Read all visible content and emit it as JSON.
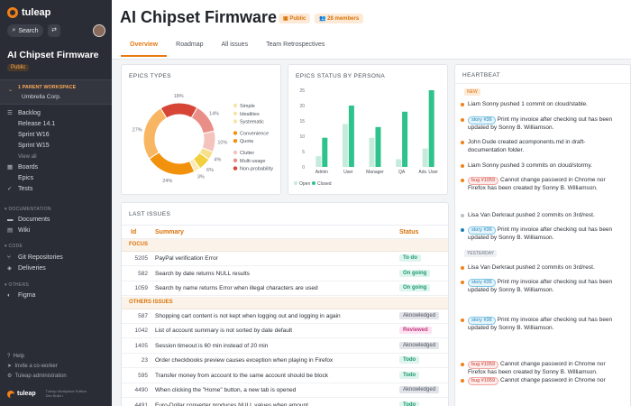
{
  "sidebar": {
    "brand": "tuleap",
    "search_label": "Search",
    "project_title": "AI Chipset Firmware",
    "public_label": "Public",
    "parent_ws_label": "1 PARENT WORKSPACE",
    "parent_ws_value": "Umbrella Corp.",
    "nav1": [
      {
        "label": "Backlog",
        "icon": "list-icon",
        "sub": false
      },
      {
        "label": "Release 14.1",
        "sub": true
      },
      {
        "label": "Sprint W16",
        "sub": true
      },
      {
        "label": "Sprint W15",
        "sub": true
      },
      {
        "label": "View all",
        "sub": true,
        "muted": true
      },
      {
        "label": "Boards",
        "icon": "board-icon",
        "sub": false
      },
      {
        "label": "Epics",
        "icon": "",
        "sub": false
      },
      {
        "label": "Tests",
        "icon": "check-icon",
        "sub": false
      }
    ],
    "section_doc": "DOCUMENTATION",
    "nav2": [
      {
        "label": "Documents",
        "icon": "folder-icon"
      },
      {
        "label": "Wiki",
        "icon": "book-icon"
      }
    ],
    "section_code": "CODE",
    "nav3": [
      {
        "label": "Git Repositories",
        "icon": "git-icon"
      },
      {
        "label": "Deliveries",
        "icon": "box-icon"
      }
    ],
    "section_others": "OTHERS",
    "nav4": [
      {
        "label": "Figma",
        "icon": "figma-icon"
      }
    ],
    "footer": [
      "Help",
      "Invite a co-worker",
      "Tuleap administration"
    ],
    "footer_brand": "tuleap",
    "footer_note": [
      "Tuleap Workplace Edition",
      "Dev Build •"
    ]
  },
  "header": {
    "title": "AI Chipset Firmware",
    "badge_public": "Public",
    "badge_members": "28 members",
    "tabs": [
      "Overview",
      "Roadmap",
      "All issues",
      "Team Retrospectives"
    ],
    "active_tab": 0
  },
  "epics_types": {
    "title": "EPICS TYPES",
    "slices": [
      {
        "label": "Simple",
        "value": 18,
        "color": "#d64535"
      },
      {
        "label": "Idealities",
        "value": 14,
        "color": "#ea8f88"
      },
      {
        "label": "Systematic",
        "value": 10,
        "color": "#f5c3bd"
      },
      {
        "label": "Convenience",
        "value": 4,
        "color": "#f6e18a"
      },
      {
        "label": "Quota",
        "value": 6,
        "color": "#f2cf3d"
      },
      {
        "label": "Clutter",
        "value": 3,
        "color": "#fbe9b6"
      },
      {
        "label": "Multi-usage",
        "value": 24,
        "color": "#f2920c"
      },
      {
        "label": "Non-probability",
        "value": 27,
        "color": "#f8b663"
      }
    ],
    "legend": [
      {
        "label": "Simple",
        "color": "#f5e6a8"
      },
      {
        "label": "Idealities",
        "color": "#f5e6a8"
      },
      {
        "label": "Systematic",
        "color": "#f5e6a8"
      },
      {
        "label": "Convenience",
        "color": "#f2920c"
      },
      {
        "label": "Quota",
        "color": "#f2920c"
      },
      {
        "label": "Clutter",
        "color": "#f5c3bd"
      },
      {
        "label": "Multi-usage",
        "color": "#ea8f88"
      },
      {
        "label": "Non-probability",
        "color": "#d64535"
      }
    ]
  },
  "chart_data": {
    "type": "bar",
    "title": "EPICS STATUS BY PERSONA",
    "categories": [
      "Admin",
      "User",
      "Manager",
      "QA",
      "Adv. User"
    ],
    "series": [
      {
        "name": "Open",
        "values": [
          3.5,
          14,
          9.5,
          2.5,
          6
        ],
        "color": "#c6ebdd"
      },
      {
        "name": "Closed",
        "values": [
          9.5,
          20,
          13,
          18,
          25
        ],
        "color": "#2ec28c"
      }
    ],
    "ylim": [
      0,
      25
    ],
    "yticks": [
      0,
      5,
      10,
      15,
      20,
      25
    ],
    "legend_position": "bottom-left"
  },
  "issues": {
    "title": "LAST ISSUES",
    "col_id": "Id",
    "col_summary": "Summary",
    "col_status": "Status",
    "focus_label": "FOCUS",
    "focus": [
      {
        "id": "5205",
        "summary": "PayPal verification Error",
        "status": "To do",
        "kind": "todo"
      },
      {
        "id": "582",
        "summary": "Search by date returns NULL results",
        "status": "On going",
        "kind": "going"
      },
      {
        "id": "1059",
        "summary": "Search by name returns Error when illegal characters are used",
        "status": "On going",
        "kind": "going"
      }
    ],
    "others_label": "OTHERS ISSUES",
    "others": [
      {
        "id": "587",
        "summary": "Shopping cart content is not kept when logging out and logging in again",
        "status": "Aknowledged",
        "kind": "ack"
      },
      {
        "id": "1042",
        "summary": "List of account summary is not sorted by date default",
        "status": "Reviewed",
        "kind": "rev"
      },
      {
        "id": "1405",
        "summary": "Session timeout is 60 min instead of 20 min",
        "status": "Aknowledged",
        "kind": "ack"
      },
      {
        "id": "23",
        "summary": "Order checkbooks preview causes exception when playing in Firefox",
        "status": "Todo",
        "kind": "todo"
      },
      {
        "id": "595",
        "summary": "Transfer money from account to the same account should be block",
        "status": "Todo",
        "kind": "todo"
      },
      {
        "id": "4490",
        "summary": "When clicking the \"Home\" button, a new tab is opened",
        "status": "Aknowledged",
        "kind": "ack"
      },
      {
        "id": "4491",
        "summary": "Euro-Dollar converter produces NULL values when amount",
        "status": "Todo",
        "kind": "todo"
      }
    ]
  },
  "heartbeat": {
    "title": "HEARTBEAT",
    "new_label": "NEW",
    "yesterday_label": "YESTERDAY",
    "entries": [
      {
        "text": "Liam Sonny pushed 1 commit on cloud/stable.",
        "chip": "",
        "color": "#f08018"
      },
      {
        "chip": "story #36",
        "chip_kind": "story",
        "text": "Print my invoice after checking out has been updated by Sonny B. Williamson.",
        "color": "#f08018"
      },
      {
        "chip": "",
        "text": "John Dude created acomponents.md in draft-documentation folder.",
        "color": "#f08018"
      },
      {
        "chip": "",
        "text": "Liam Sonny pushed 3 commits on cloud/stormy.",
        "color": "#f08018"
      },
      {
        "chip": "bug #1059",
        "chip_kind": "bug",
        "text": "Cannot change password in Chrome nor Firefox has been created by Sonny B. Williamson.",
        "color": "#f08018"
      },
      {
        "chip": "",
        "text": "Lisa Van Derkraut pushed 2 commits on 3rd/rest.",
        "color": "#b9bec7"
      },
      {
        "chip": "story #36",
        "chip_kind": "story",
        "text": "Print my invoice after checking out has been updated by Sonny B. Williamson.",
        "color": "#1d7fb3"
      },
      {
        "chip": "",
        "text": "Lisa Van Derkraut pushed 2 commits on 3rd/rest.",
        "color": "#f08018"
      },
      {
        "chip": "story #36",
        "chip_kind": "story",
        "text": "Print my invoice after checking out has been updated by Sonny B. Williamson.",
        "color": "#f08018"
      },
      {
        "chip": "story #36",
        "chip_kind": "story",
        "text": "Print my invoice after checking out has been updated by Sonny B. Williamson.",
        "color": "#f08018"
      },
      {
        "chip": "bug #1059",
        "chip_kind": "bug",
        "text": "Cannot change password in Chrome nor Firefox has been created by Sonny B. Williamson.",
        "color": "#f08018"
      },
      {
        "chip": "bug #1059",
        "chip_kind": "bug",
        "text": "Cannot change password in Chrome nor",
        "color": "#f08018"
      }
    ]
  }
}
